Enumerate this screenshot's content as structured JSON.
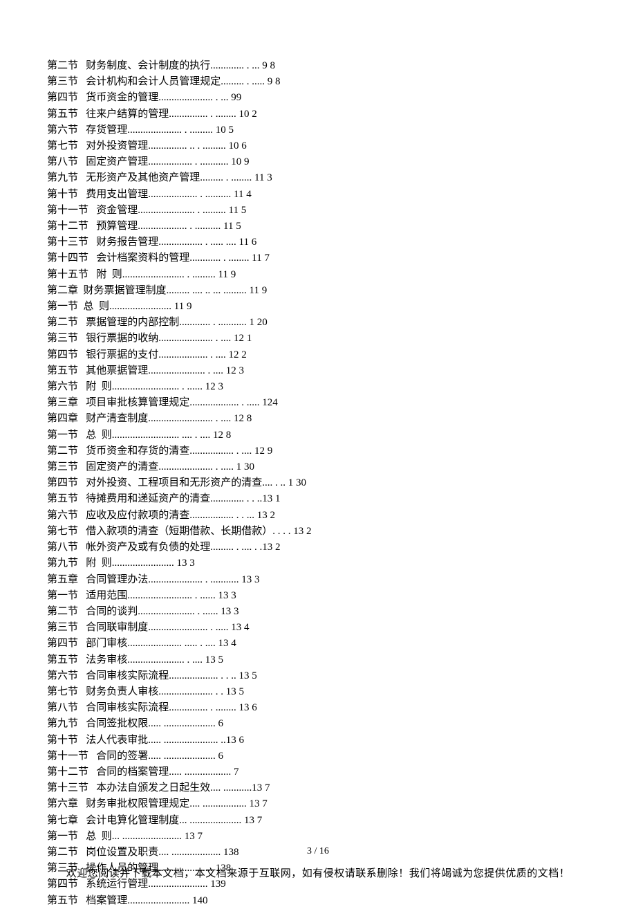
{
  "toc": [
    "第二节   财务制度、会计制度的执行............. . ... 9 8",
    "第三节   会计机构和会计人员管理规定......... . ..... 9 8",
    "第四节   货币资金的管理..................... . ... 99",
    "第五节   往来户结算的管理............... . ........ 10 2",
    "第六节   存货管理..................... . ......... 10 5",
    "第七节   对外投资管理............... .. . ......... 10 6",
    "第八节   固定资产管理................. . ........... 10 9",
    "第九节   无形资产及其他资产管理......... . ........ 11 3",
    "第十节   费用支出管理................... . .......... 11 4",
    "第十一节   资金管理...................... . ......... 11 5",
    "第十二节   预算管理................... . .......... 11 5",
    "第十三节   财务报告管理................. . ..... .... 11 6",
    "第十四节   会计档案资料的管理............ . ........ 11 7",
    "第十五节   附  则........................ . ......... 11 9",
    "第二章  财务票据管理制度......... .... .. ... ......... 11 9",
    "第一节  总  则........................ 11 9",
    "第二节   票据管理的内部控制............ . ........... 1 20",
    "第三节   银行票据的收纳..................... . .... 12 1",
    "第四节   银行票据的支付................... . .... 12 2",
    "第五节   其他票据管理...................... . .... 12 3",
    "第六节   附  则.......................... . ...... 12 3",
    "第三章   项目审批核算管理规定................... . ..... 124",
    "第四章   财产清查制度......................... . .... 12 8",
    "第一节   总  则.......................... .... . .... 12 8",
    "第二节   货币资金和存货的清查................. . .... 12 9",
    "第三节   固定资产的清查..................... . ..... 1 30",
    "第四节   对外投资、工程项目和无形资产的清查.... . .. 1 30",
    "第五节   待摊费用和递延资产的清查............. . . ..13 1",
    "第六节   应收及应付款项的清查................. . . ... 13 2",
    "第七节   借入款项的清查（短期借款、长期借款）. . . . 13 2",
    "第八节   帐外资产及或有负债的处理......... . .... . .13 2",
    "第九节   附  则........................ 13 3",
    "第五章   合同管理办法..................... . ........... 13 3",
    "第一节   适用范围......................... . ...... 13 3",
    "第二节   合同的谈判...................... . ...... 13 3",
    "第三节   合同联审制度....................... . ..... 13 4",
    "第四节   部门审核..................... ..... . .... 13 4",
    "第五节   法务审核...................... . .... 13 5",
    "第六节   合同审核实际流程................... . . .. 13 5",
    "第七节   财务负责人审核..................... . . 13 5",
    "第八节   合同审核实际流程............... . ........ 13 6",
    "第九节   合同签批权限..... .................... 6",
    "第十节   法人代表审批..... ..................... ..13 6",
    "第十一节   合同的签署..... .................... 6",
    "第十二节   合同的档案管理..... .................. 7",
    "第十三节   本办法自颁发之日起生效.... ...........13 7",
    "第六章   财务审批权限管理规定.... ................. 13 7",
    "第七章   会计电算化管理制度... .................... 13 7",
    "第一节   总  则... ....................... 13 7",
    "第二节   岗位设置及职责.... ................... 138",
    "第三节   操作人员的管理..................... 138",
    "第四节   系统运行管理....................... 139",
    "第五节   档案管理........................ 140"
  ],
  "page": {
    "number": "3  /  16",
    "footer": "欢迎您阅读并下载本文档，本文档来源于互联网，如有侵权请联系删除！我们将竭诚为您提供优质的文档！"
  }
}
